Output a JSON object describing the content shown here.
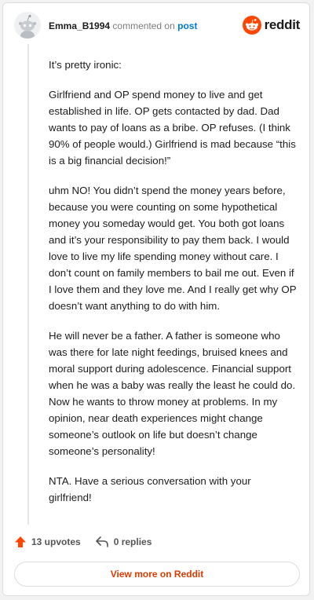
{
  "header": {
    "username": "Emma_B1994",
    "action_text": "commented on",
    "post_link": "post",
    "logo_text": "reddit"
  },
  "comment": {
    "paragraphs": [
      "It’s pretty ironic:",
      "Girlfriend and OP spend money to live and get established in life. OP gets contacted by dad. Dad wants to pay of loans as a bribe. OP refuses. (I think 90% of people would.) Girlfriend is mad because “this is a big financial decision!”",
      "uhm NO! You didn’t spend the money years before, because you were counting on some hypothetical money you someday would get. You both got loans and it’s your responsibility to pay them back. I would love to live my life spending money without care. I don’t count on family members to bail me out. Even if I love them and they love me. And I really get why OP doesn’t want anything to do with him.",
      "He will never be a father. A father is someone who was there for late night feedings, bruised knees and moral support during adolescence. Financial support when he was a baby was really the least he could do. Now he wants to throw money at problems. In my opinion, near death experiences might change someone’s outlook on life but doesn’t change someone’s personality!",
      "NTA. Have a serious conversation with your girlfriend!"
    ]
  },
  "actions": {
    "upvotes": "13 upvotes",
    "replies": "0 replies"
  },
  "footer": {
    "view_more": "View more on Reddit"
  },
  "colors": {
    "brand": "#ff4500",
    "link": "#0079d3",
    "view_more": "#d93a00"
  }
}
